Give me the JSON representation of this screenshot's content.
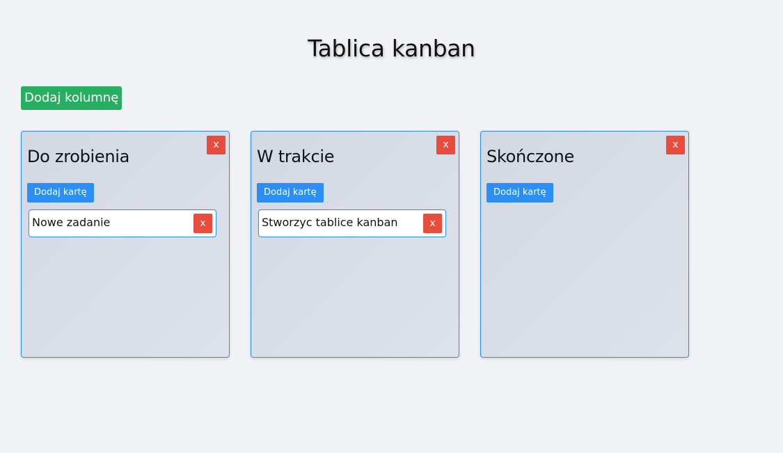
{
  "page": {
    "title": "Tablica kanban",
    "add_column_label": "Dodaj kolumnę"
  },
  "columns": [
    {
      "title": "Do zrobienia",
      "delete_label": "x",
      "add_card_label": "Dodaj kartę",
      "cards": [
        {
          "text": "Nowe zadanie",
          "delete_label": "x"
        }
      ]
    },
    {
      "title": "W trakcie",
      "delete_label": "x",
      "add_card_label": "Dodaj kartę",
      "cards": [
        {
          "text": "Stworzyc tablice kanban",
          "delete_label": "x"
        }
      ]
    },
    {
      "title": "Skończone",
      "delete_label": "x",
      "add_card_label": "Dodaj kartę",
      "cards": []
    }
  ],
  "colors": {
    "background": "#f0f2f5",
    "add_column_button": "#27ae60",
    "add_card_button": "#2b8ef5",
    "delete_button": "#e74c3c",
    "column_border": "#2b8ef5",
    "card_background": "#ffffff"
  }
}
